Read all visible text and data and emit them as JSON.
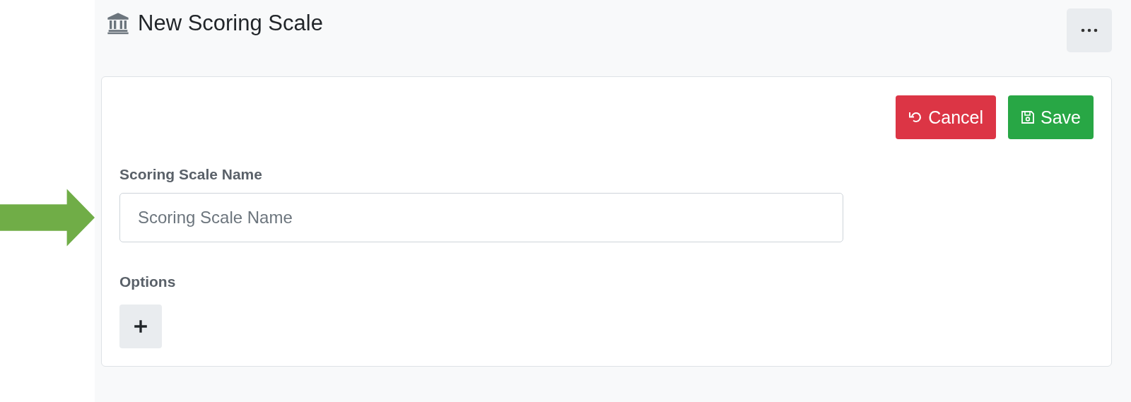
{
  "page": {
    "title": "New Scoring Scale"
  },
  "actions": [
    {
      "kind": "cancel",
      "label": "Cancel"
    },
    {
      "kind": "save",
      "label": "Save"
    }
  ],
  "form": {
    "name_label": "Scoring Scale Name",
    "name_placeholder": "Scoring Scale Name",
    "options_label": "Options"
  }
}
